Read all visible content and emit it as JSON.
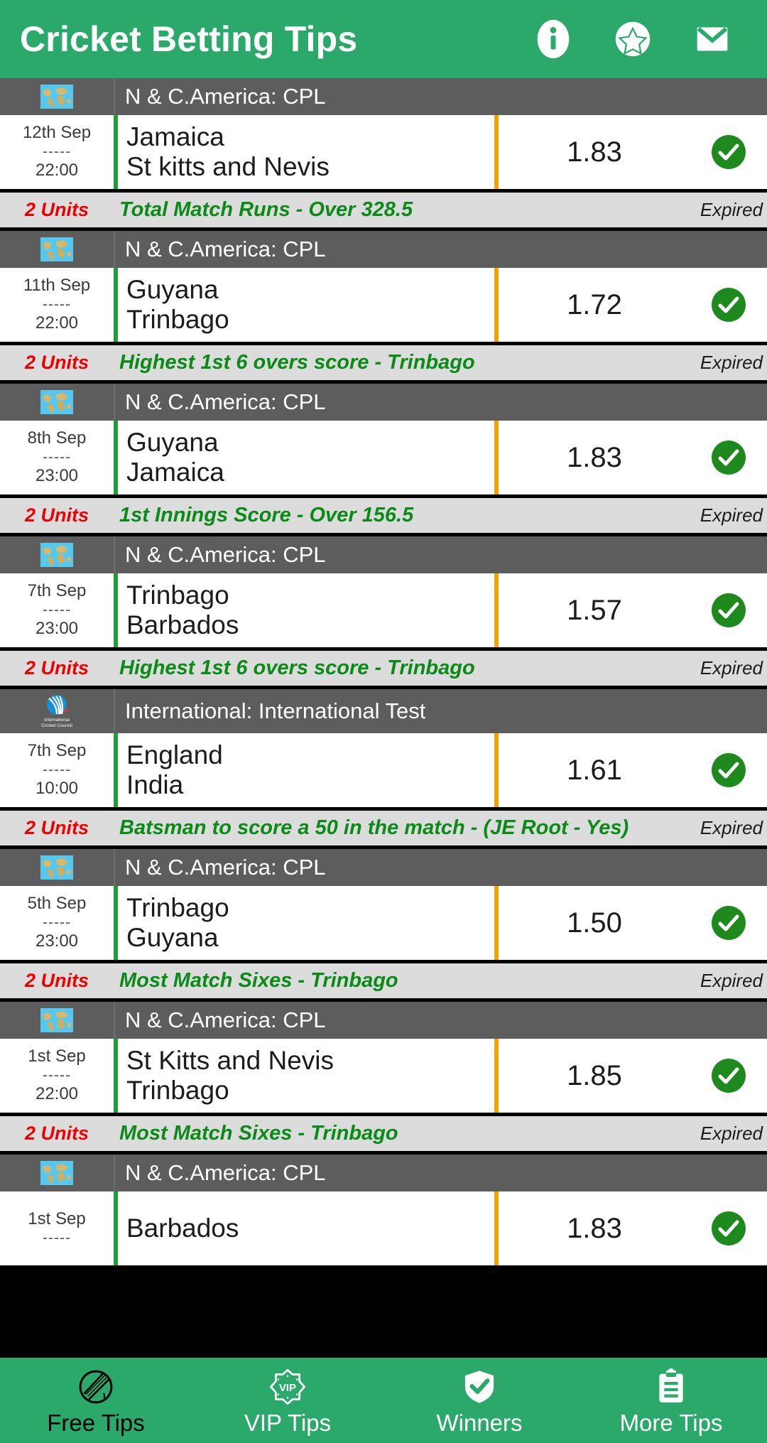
{
  "app": {
    "title": "Cricket Betting Tips",
    "brand_color": "#2aa96a",
    "actions": [
      {
        "name": "info-icon",
        "label": "Info"
      },
      {
        "name": "star-icon",
        "label": "Rate"
      },
      {
        "name": "mail-icon",
        "label": "Contact"
      }
    ]
  },
  "colors": {
    "accent": "#2aa96a",
    "league_header": "#5d5d5d",
    "tip_row": "#dcdcdc",
    "units": "#ee0000",
    "tip_text": "#0a8a16",
    "team_bar": "#1e9e35",
    "odds_bar": "#f5a200",
    "tick": "#1e8a1e"
  },
  "matches": [
    {
      "league": "N & C.America: CPL",
      "league_icon": "world-map-icon",
      "date": "12th Sep",
      "separator": "-----",
      "time": "22:00",
      "team1": "Jamaica",
      "team2": "St kitts and Nevis",
      "odds": "1.83",
      "result": "won",
      "units": "2 Units",
      "tip": "Total Match Runs - Over 328.5",
      "status": "Expired"
    },
    {
      "league": "N & C.America: CPL",
      "league_icon": "world-map-icon",
      "date": "11th Sep",
      "separator": "-----",
      "time": "22:00",
      "team1": "Guyana",
      "team2": "Trinbago",
      "odds": "1.72",
      "result": "won",
      "units": "2 Units",
      "tip": "Highest 1st 6 overs score - Trinbago",
      "status": "Expired"
    },
    {
      "league": "N & C.America: CPL",
      "league_icon": "world-map-icon",
      "date": "8th Sep",
      "separator": "-----",
      "time": "23:00",
      "team1": "Guyana",
      "team2": "Jamaica",
      "odds": "1.83",
      "result": "won",
      "units": "2 Units",
      "tip": "1st Innings Score - Over 156.5",
      "status": "Expired"
    },
    {
      "league": "N & C.America: CPL",
      "league_icon": "world-map-icon",
      "date": "7th Sep",
      "separator": "-----",
      "time": "23:00",
      "team1": "Trinbago",
      "team2": "Barbados",
      "odds": "1.57",
      "result": "won",
      "units": "2 Units",
      "tip": "Highest 1st 6 overs score - Trinbago",
      "status": "Expired"
    },
    {
      "league": "International: International Test",
      "league_icon": "icc-logo-icon",
      "date": "7th Sep",
      "separator": "-----",
      "time": "10:00",
      "team1": "England",
      "team2": "India",
      "odds": "1.61",
      "result": "won",
      "units": "2 Units",
      "tip": "Batsman to score a 50 in the match - (JE Root - Yes)",
      "status": "Expired"
    },
    {
      "league": "N & C.America: CPL",
      "league_icon": "world-map-icon",
      "date": "5th Sep",
      "separator": "-----",
      "time": "23:00",
      "team1": "Trinbago",
      "team2": "Guyana",
      "odds": "1.50",
      "result": "won",
      "units": "2 Units",
      "tip": "Most Match Sixes - Trinbago",
      "status": "Expired"
    },
    {
      "league": "N & C.America: CPL",
      "league_icon": "world-map-icon",
      "date": "1st Sep",
      "separator": "-----",
      "time": "22:00",
      "team1": "St Kitts and Nevis",
      "team2": "Trinbago",
      "odds": "1.85",
      "result": "won",
      "units": "2 Units",
      "tip": "Most Match Sixes - Trinbago",
      "status": "Expired"
    },
    {
      "league": "N & C.America: CPL",
      "league_icon": "world-map-icon",
      "date": "1st Sep",
      "separator": "-----",
      "time": "",
      "team1": "Barbados",
      "team2": "",
      "odds": "1.83",
      "result": "won",
      "units": "",
      "tip": "",
      "status": ""
    }
  ],
  "bottom_nav": {
    "items": [
      {
        "label": "Free Tips",
        "icon": "cricket-ball-icon",
        "active": true
      },
      {
        "label": "VIP Tips",
        "icon": "vip-badge-icon",
        "active": false
      },
      {
        "label": "Winners",
        "icon": "shield-check-icon",
        "active": false
      },
      {
        "label": "More Tips",
        "icon": "clipboard-icon",
        "active": false
      }
    ]
  }
}
